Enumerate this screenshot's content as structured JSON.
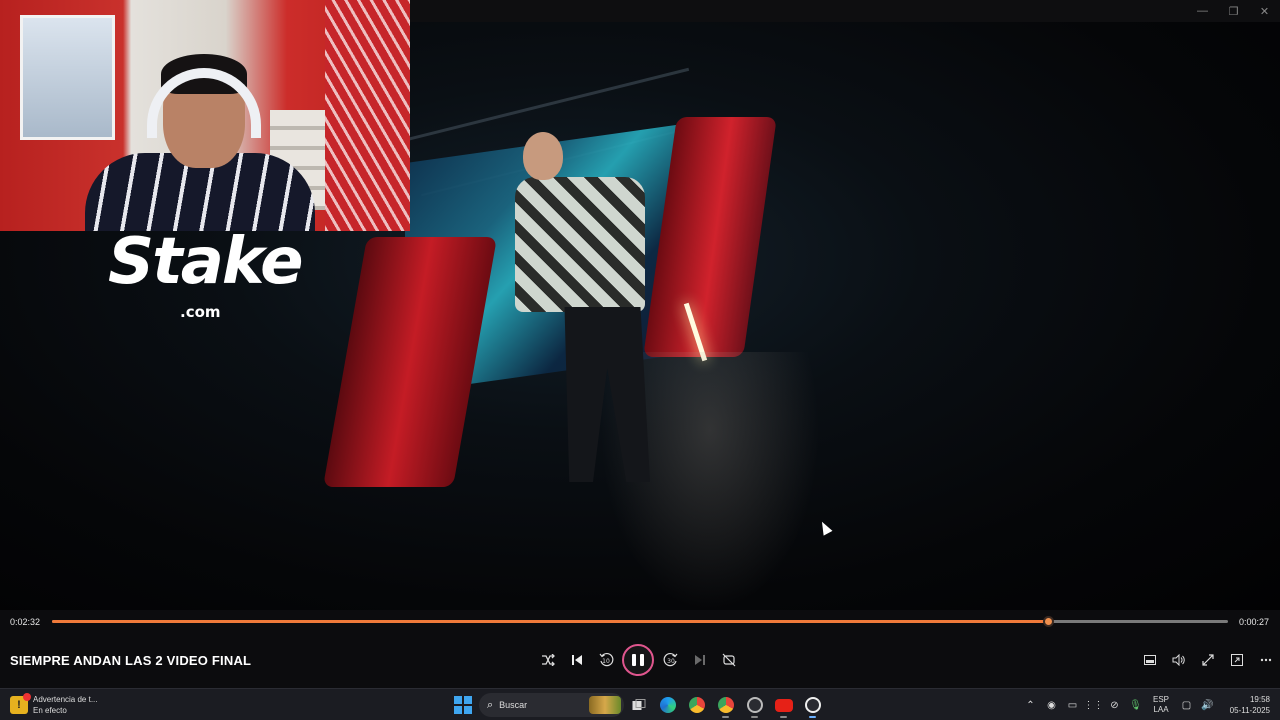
{
  "window": {
    "controls": [
      "—",
      "❐",
      "✕"
    ]
  },
  "overlay": {
    "logo_word": "Stake",
    "logo_suffix": ".com"
  },
  "player": {
    "time_current": "0:02:32",
    "time_remaining": "0:00:27",
    "progress": 0.847,
    "title": "SIEMPRE ANDAN LAS 2 VIDEO FINAL",
    "skip_back_label": "10",
    "skip_forward_label": "30",
    "accent_color": "#f07a3a",
    "play_ring_color": "#e0568e",
    "icons": [
      "shuffle-icon",
      "previous-icon",
      "skip-back-10-icon",
      "pause-icon",
      "skip-forward-30-icon",
      "next-icon",
      "repeat-off-icon",
      "miniplayer-icon",
      "volume-icon",
      "fullscreen-icon",
      "cast-icon",
      "more-icon"
    ]
  },
  "taskbar": {
    "notification_title": "Advertencia de t...",
    "notification_status": "En efecto",
    "search_placeholder": "Buscar",
    "lang_line1": "ESP",
    "lang_line2": "LAA",
    "clock_time": "19:58",
    "clock_date": "05-11-2025"
  }
}
